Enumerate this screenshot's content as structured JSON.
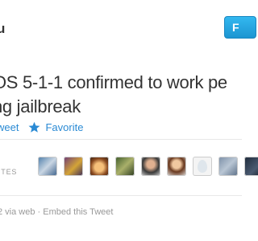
{
  "header": {
    "handle": "u",
    "follow_label": "F"
  },
  "tweet": {
    "line1": "OS 5-1-1 confirmed to work pe",
    "line2": "ng jailbreak"
  },
  "actions": {
    "retweet_label": "weet",
    "favorite_label": "Favorite",
    "favorite_icon": "star-icon",
    "link_color": "#2a8ad4"
  },
  "favorites": {
    "label": "ITES",
    "avatar_count": 9
  },
  "meta": {
    "text": "2 via web · Embed this Tweet"
  },
  "colors": {
    "follow_button": "#1c95d1",
    "divider": "#e8e8e8",
    "muted_text": "#999999"
  }
}
